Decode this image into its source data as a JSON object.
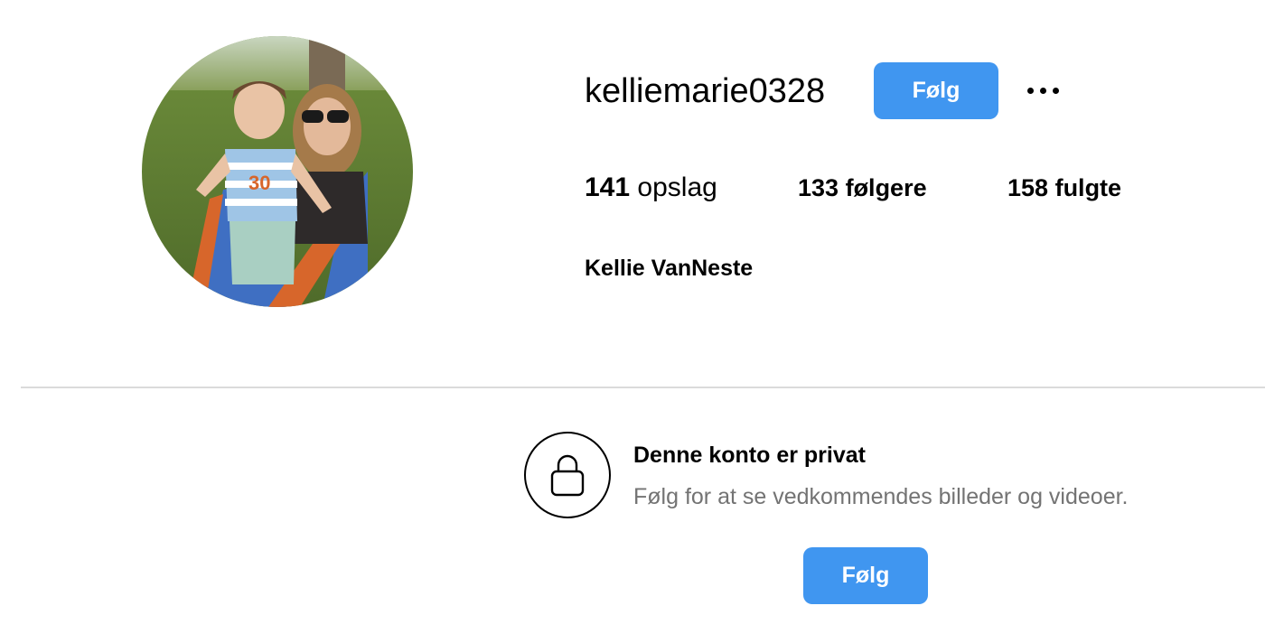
{
  "profile": {
    "username": "kelliemarie0328",
    "full_name": "Kellie VanNeste",
    "avatar_alt": "profile-photo"
  },
  "actions": {
    "follow_label": "Følg",
    "more_label": "..."
  },
  "stats": {
    "posts_count": "141",
    "posts_label": "opslag",
    "followers_count": "133",
    "followers_label": "følgere",
    "following_count": "158",
    "following_label": "fulgte"
  },
  "private_notice": {
    "title": "Denne konto er privat",
    "subtitle": "Følg for at se vedkommendes billeder og videoer.",
    "follow_label": "Følg"
  },
  "colors": {
    "accent": "#4096f0",
    "secondary_text": "#737373",
    "divider": "#dbdbdb"
  }
}
